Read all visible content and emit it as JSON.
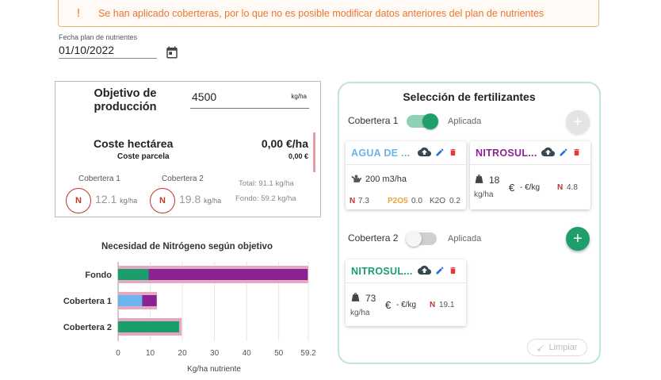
{
  "alert": {
    "icon": "!",
    "text": "Se han aplicado coberteras, por lo que no es posible modificar datos anteriores del plan de nutrientes"
  },
  "date": {
    "label": "Fecha plan de nutrientes",
    "value": "01/10/2022"
  },
  "production": {
    "objective_label": "Objetivo de producción",
    "objective_value": "4500",
    "objective_unit": "kg/ha",
    "cost_label": "Coste hectárea",
    "cost_value": "0,00 €/ha",
    "parcel_label": "Coste parcela",
    "parcel_value": "0,00 €",
    "cobertera1_label": "Cobertera 1",
    "cobertera2_label": "Cobertera 2",
    "n_badge": "N",
    "n1_value": "12.1",
    "n2_value": "19.8",
    "n_unit": "kg/ha",
    "total": "Total: 91.1 kg/ha",
    "fondo": "Fondo: 59.2 kg/ha"
  },
  "chart_data": {
    "type": "bar",
    "orientation": "horizontal",
    "title": "Necesidad de Nitrógeno según objetivo",
    "xlabel": "Kg/ha nutriente",
    "categories": [
      "Fondo",
      "Cobertera 1",
      "Cobertera 2"
    ],
    "xlim": [
      0,
      59.2
    ],
    "xticks": [
      "0",
      "10",
      "20",
      "30",
      "40",
      "50",
      "59.2"
    ],
    "target": [
      59.2,
      12.1,
      19.8
    ],
    "series": [
      {
        "color": "#1a9e6b",
        "values": [
          9.5,
          0,
          19
        ]
      },
      {
        "color": "#6ab4f0",
        "values": [
          0,
          7.5,
          0
        ]
      },
      {
        "color": "#8a2294",
        "values": [
          49.5,
          4.5,
          0
        ]
      }
    ],
    "target_color": "#e6a8c0"
  },
  "fertilizers": {
    "title": "Selección de fertilizantes",
    "cobertera1_label": "Cobertera 1",
    "cobertera2_label": "Cobertera 2",
    "aplicada": "Aplicada",
    "add_icon": "+",
    "card1": {
      "name": "AGUA DE ...",
      "amount": "200 m3/ha",
      "n_label": "N",
      "n_value": "7.3",
      "p_label": "P2O5",
      "p_value": "0.0",
      "k_label": "K2O",
      "k_value": "0.2",
      "name_color": "#6ab4e8"
    },
    "card2": {
      "name": "NITROSUL...",
      "amount": "18",
      "unit": "kg/ha",
      "price": "- €/kg",
      "euro": "€",
      "n_label": "N",
      "n_value": "4.8",
      "name_color": "#8a2294"
    },
    "card3": {
      "name": "NITROSUL...",
      "amount": "73",
      "unit": "kg/ha",
      "price": "- €/kg",
      "euro": "€",
      "n_label": "N",
      "n_value": "19.1",
      "name_color": "#1a9e6b"
    },
    "clear_label": "Limpiar"
  }
}
